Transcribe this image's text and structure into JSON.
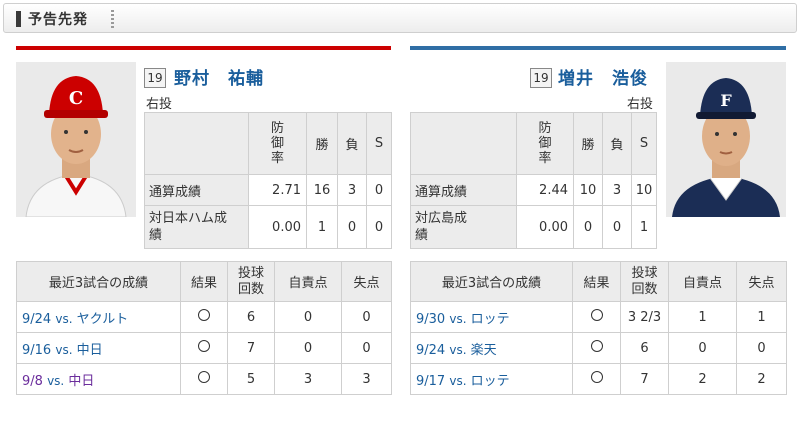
{
  "header": {
    "title": "予告先発"
  },
  "colors": {
    "carp_red": "#cc0000",
    "fighters_blue": "#2f6ea5",
    "link_blue": "#1a5e9c",
    "visited_purple": "#6b2d9c"
  },
  "left": {
    "number": "19",
    "name": "野村　祐輔",
    "hand": "右投",
    "stats_headers": {
      "era": "防御率",
      "w": "勝",
      "l": "負",
      "s": "S"
    },
    "stats_rows": [
      {
        "label": "通算成績",
        "era": "2.71",
        "w": "16",
        "l": "3",
        "s": "0"
      },
      {
        "label": "対日本ハム成績",
        "era": "0.00",
        "w": "1",
        "l": "0",
        "s": "0"
      }
    ],
    "recent_headers": {
      "game": "最近3試合の成績",
      "result": "結果",
      "ip": "投球回数",
      "er": "自責点",
      "r": "失点"
    },
    "recent": [
      {
        "date": "9/24",
        "vs": "vs.",
        "opp": "ヤクルト",
        "result": "○",
        "ip": "6",
        "er": "0",
        "r": "0"
      },
      {
        "date": "9/16",
        "vs": "vs.",
        "opp": "中日",
        "result": "○",
        "ip": "7",
        "er": "0",
        "r": "0"
      },
      {
        "date": "9/8",
        "vs": "vs.",
        "opp": "中日",
        "result": "○",
        "ip": "5",
        "er": "3",
        "r": "3"
      }
    ]
  },
  "right": {
    "number": "19",
    "name": "増井　浩俊",
    "hand": "右投",
    "stats_headers": {
      "era": "防御率",
      "w": "勝",
      "l": "負",
      "s": "S"
    },
    "stats_rows": [
      {
        "label": "通算成績",
        "era": "2.44",
        "w": "10",
        "l": "3",
        "s": "10"
      },
      {
        "label": "対広島成績",
        "era": "0.00",
        "w": "0",
        "l": "0",
        "s": "1"
      }
    ],
    "recent_headers": {
      "game": "最近3試合の成績",
      "result": "結果",
      "ip": "投球回数",
      "er": "自責点",
      "r": "失点"
    },
    "recent": [
      {
        "date": "9/30",
        "vs": "vs.",
        "opp": "ロッテ",
        "result": "○",
        "ip": "3 2/3",
        "er": "1",
        "r": "1"
      },
      {
        "date": "9/24",
        "vs": "vs.",
        "opp": "楽天",
        "result": "○",
        "ip": "6",
        "er": "0",
        "r": "0"
      },
      {
        "date": "9/17",
        "vs": "vs.",
        "opp": "ロッテ",
        "result": "○",
        "ip": "7",
        "er": "2",
        "r": "2"
      }
    ]
  }
}
